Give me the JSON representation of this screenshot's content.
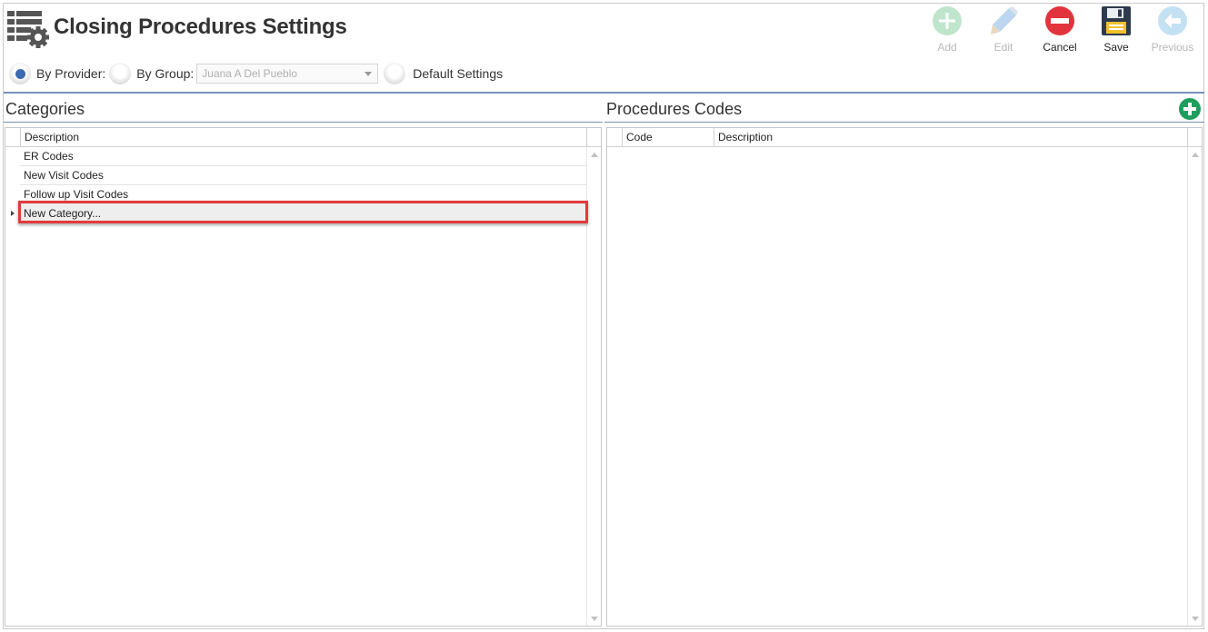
{
  "header": {
    "title": "Closing Procedures Settings"
  },
  "toolbar": {
    "add": "Add",
    "edit": "Edit",
    "cancel": "Cancel",
    "save": "Save",
    "previous": "Previous"
  },
  "filter": {
    "by_provider": "By Provider:",
    "by_group": "By Group:",
    "group_value": "Juana A Del Pueblo",
    "default_settings": "Default Settings"
  },
  "categories": {
    "title": "Categories",
    "column_description": "Description",
    "rows": [
      "ER Codes",
      "New Visit Codes",
      "Follow up Visit Codes",
      "New Category..."
    ]
  },
  "procedures": {
    "title": "Procedures Codes",
    "column_code": "Code",
    "column_description": "Description"
  },
  "colors": {
    "accent_blue": "#3d6bb3",
    "add_green": "#1e9e5e",
    "cancel_red": "#e2343c",
    "highlight_red": "#e23a3a"
  }
}
